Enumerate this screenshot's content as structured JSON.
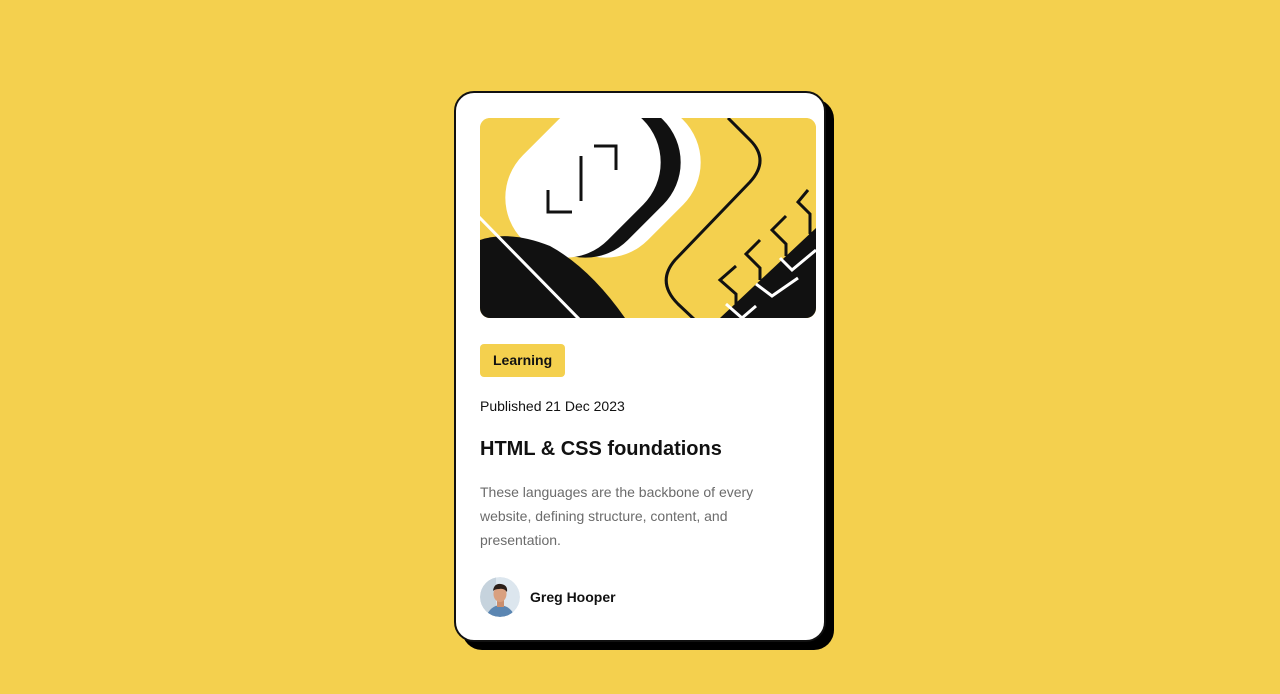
{
  "card": {
    "tag": "Learning",
    "published": "Published 21 Dec 2023",
    "title": "HTML & CSS foundations",
    "description": "These languages are the backbone of every website, defining structure, content, and presentation.",
    "author": {
      "name": "Greg Hooper",
      "avatar_icon": "person-avatar-icon"
    },
    "hero_icon": "abstract-illustration"
  },
  "colors": {
    "background": "#F4D04E",
    "card": "#FFFFFF",
    "ink": "#111111",
    "muted": "#6B6B6B"
  }
}
